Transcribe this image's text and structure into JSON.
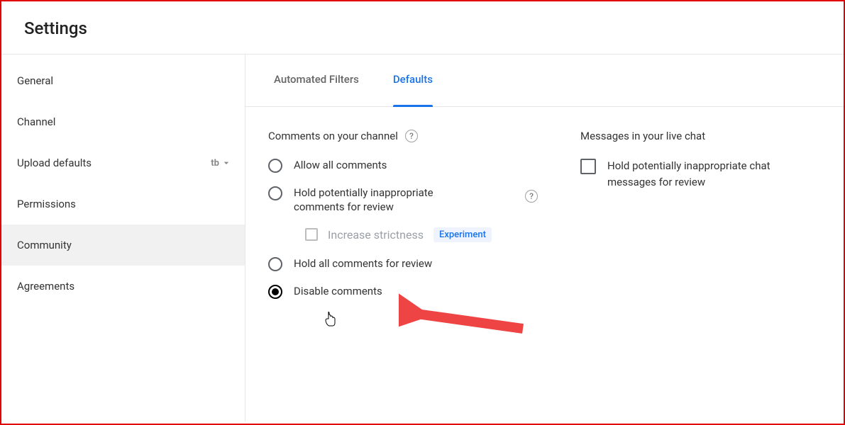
{
  "page_title": "Settings",
  "sidebar": {
    "items": [
      {
        "label": "General"
      },
      {
        "label": "Channel"
      },
      {
        "label": "Upload defaults",
        "has_badge": true
      },
      {
        "label": "Permissions"
      },
      {
        "label": "Community",
        "active": true
      },
      {
        "label": "Agreements"
      }
    ]
  },
  "tabs": [
    {
      "label": "Automated Filters"
    },
    {
      "label": "Defaults",
      "active": true
    }
  ],
  "comments_section": {
    "title": "Comments on your channel",
    "options": [
      {
        "label": "Allow all comments"
      },
      {
        "label": "Hold potentially inappropriate comments for review",
        "has_help": true
      },
      {
        "label": "Hold all comments for review"
      },
      {
        "label": "Disable comments",
        "checked": true
      }
    ],
    "strictness": {
      "label": "Increase strictness",
      "badge": "Experiment"
    }
  },
  "livechat_section": {
    "title": "Messages in your live chat",
    "option": {
      "label": "Hold potentially inappropriate chat messages for review"
    }
  }
}
